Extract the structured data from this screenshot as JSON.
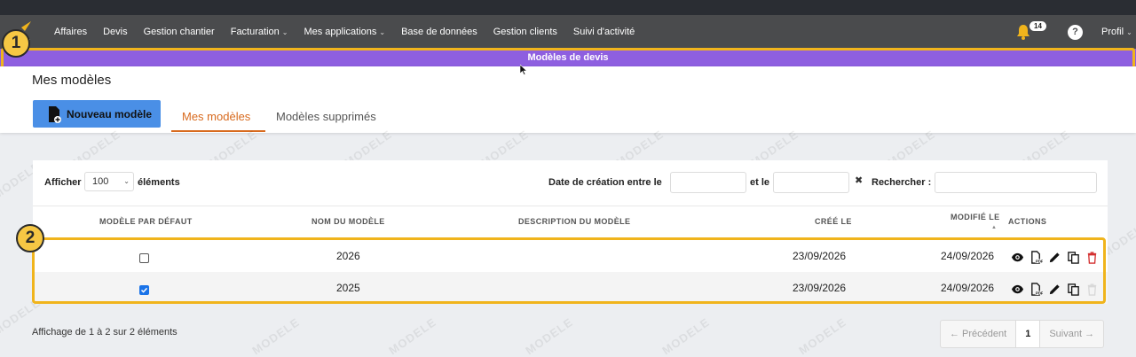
{
  "nav": {
    "items": [
      {
        "label": "Affaires",
        "dropdown": false
      },
      {
        "label": "Devis",
        "dropdown": false
      },
      {
        "label": "Gestion chantier",
        "dropdown": false
      },
      {
        "label": "Facturation",
        "dropdown": true
      },
      {
        "label": "Mes applications",
        "dropdown": true
      },
      {
        "label": "Base de données",
        "dropdown": false
      },
      {
        "label": "Gestion clients",
        "dropdown": false
      },
      {
        "label": "Suivi d'activité",
        "dropdown": false
      }
    ],
    "notification_count": "14",
    "help_label": "?",
    "profile_label": "Profil"
  },
  "banner": {
    "title": "Modèles de devis"
  },
  "callouts": {
    "one": "1",
    "two": "2"
  },
  "page": {
    "title": "Mes modèles",
    "new_button": "Nouveau modèle",
    "tabs": [
      {
        "label": "Mes modèles",
        "active": true
      },
      {
        "label": "Modèles supprimés",
        "active": false
      }
    ],
    "watermark": "MODELE"
  },
  "filters": {
    "show_label": "Afficher",
    "page_size": "100",
    "elements_label": "éléments",
    "date_label": "Date de création entre le",
    "and_label": "et le",
    "search_label": "Rechercher :"
  },
  "table": {
    "columns": [
      "MODÈLE PAR DÉFAUT",
      "NOM DU MODÈLE",
      "DESCRIPTION DU MODÈLE",
      "CRÉÉ LE",
      "MODIFIÉ LE",
      "ACTIONS"
    ],
    "rows": [
      {
        "default": false,
        "name": "2026",
        "description": "",
        "created": "23/09/2026",
        "modified": "24/09/2026",
        "delete_enabled": true
      },
      {
        "default": true,
        "name": "2025",
        "description": "",
        "created": "23/09/2026",
        "modified": "24/09/2026",
        "delete_enabled": false
      }
    ]
  },
  "footer": {
    "info": "Affichage de 1 à 2 sur 2 éléments",
    "prev": "← Précédent",
    "page": "1",
    "next": "Suivant →"
  },
  "colors": {
    "navbar": "#4a4b4d",
    "banner": "#8e5fe0",
    "highlight": "#f0b41c",
    "accent_tab": "#d86a1e",
    "primary_button": "#4a8fe6",
    "delete_icon": "#d32f2f"
  }
}
